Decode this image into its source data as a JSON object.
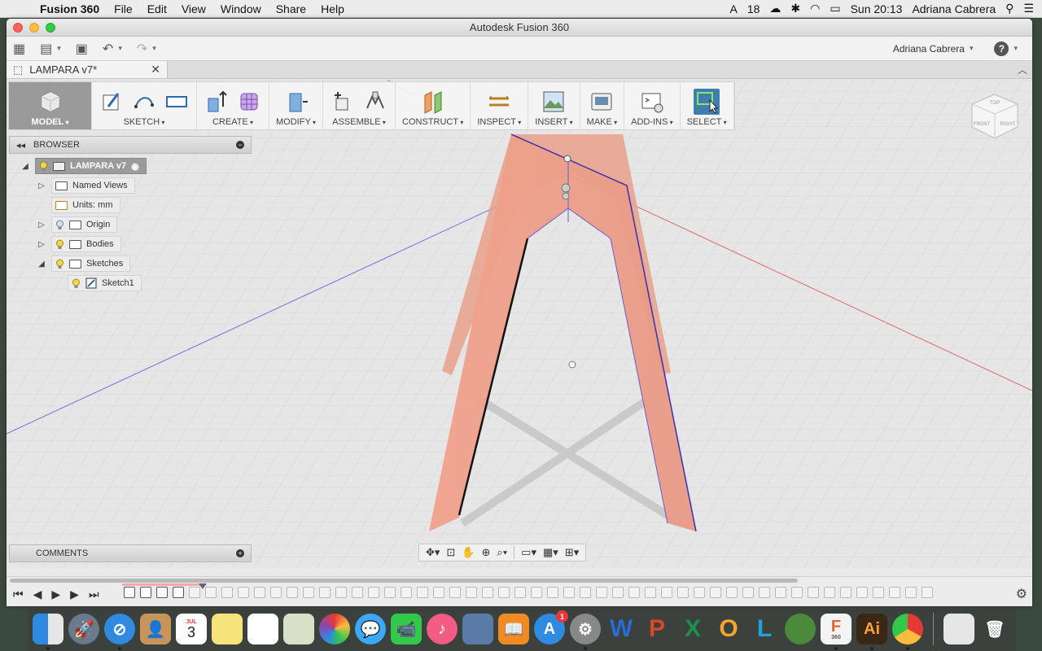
{
  "menubar": {
    "app_name": "Fusion 360",
    "items": [
      "File",
      "Edit",
      "View",
      "Window",
      "Share",
      "Help"
    ],
    "status_count": "18",
    "clock": "Sun 20:13",
    "user": "Adriana Cabrera"
  },
  "window": {
    "title": "Autodesk Fusion 360",
    "user": "Adriana Cabrera"
  },
  "document_tab": {
    "title": "LAMPARA v7*"
  },
  "toolbar": {
    "model_label": "MODEL",
    "sketch_label": "SKETCH",
    "create_label": "CREATE",
    "modify_label": "MODIFY",
    "assemble_label": "ASSEMBLE",
    "construct_label": "CONSTRUCT",
    "inspect_label": "INSPECT",
    "insert_label": "INSERT",
    "make_label": "MAKE",
    "addins_label": "ADD-INS",
    "select_label": "SELECT"
  },
  "browser": {
    "title": "BROWSER",
    "root": "LAMPARA v7",
    "named_views": "Named Views",
    "units": "Units: mm",
    "origin": "Origin",
    "bodies": "Bodies",
    "sketches": "Sketches",
    "sketch1": "Sketch1"
  },
  "comments": {
    "title": "COMMENTS"
  },
  "viewcube": {
    "top": "TOP",
    "front": "FRONT",
    "right": "RIGHT"
  },
  "dock": {
    "calendar_month": "JUL",
    "calendar_day": "3",
    "appstore_badge": "1",
    "fusion_label": "360"
  },
  "colors": {
    "body_fill": "#f2a890",
    "body_edge": "#3a2fb0",
    "axis_red": "#e06a6a",
    "axis_blue": "#6b6be0",
    "select_accent": "#3f7fae"
  }
}
